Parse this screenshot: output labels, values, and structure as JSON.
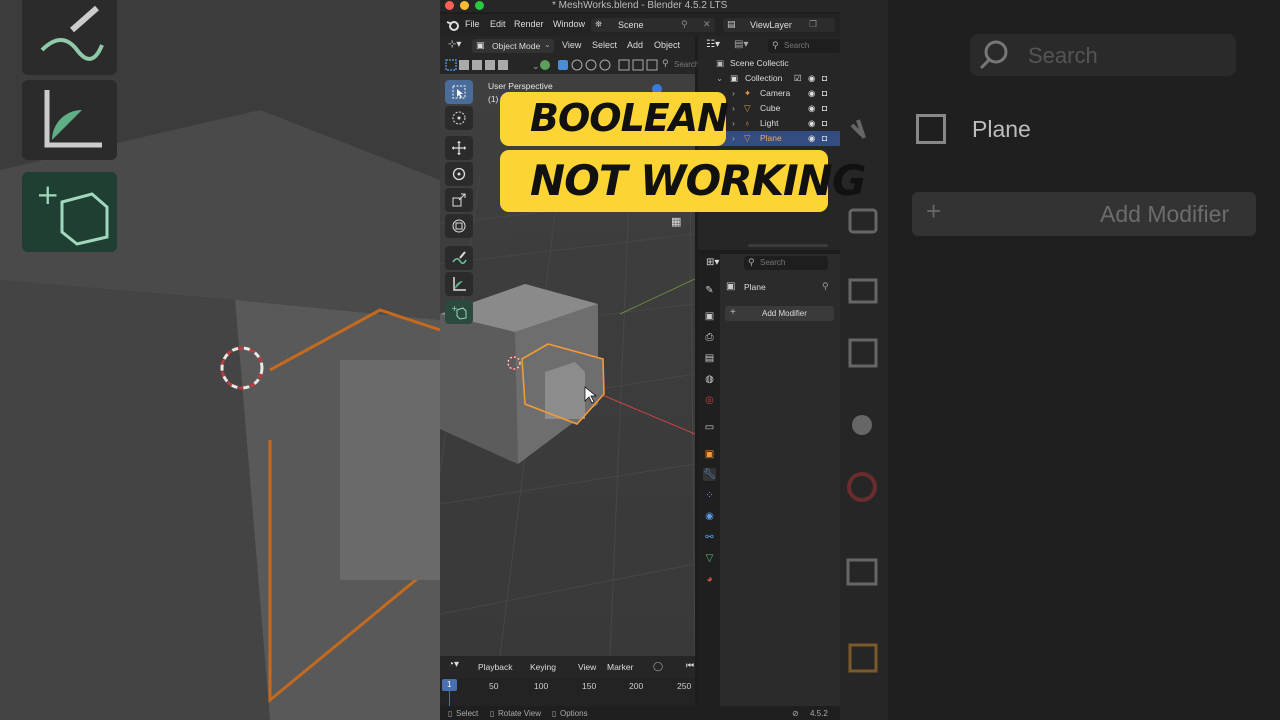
{
  "window": {
    "title": "* MeshWorks.blend - Blender 4.5.2 LTS"
  },
  "topbar": {
    "menus": [
      "File",
      "Edit",
      "Render",
      "Window"
    ],
    "scene": "Scene",
    "view_layer": "ViewLayer"
  },
  "viewport": {
    "mode": "Object Mode",
    "menus": [
      "View",
      "Select",
      "Add",
      "Object"
    ],
    "search_placeholder": "Search",
    "perspective_label": "User Perspective",
    "collection_label": "(1)"
  },
  "overlay": {
    "line1": "BOOLEAN",
    "line2": "NOT WORKING"
  },
  "outliner": {
    "search_placeholder": "Search",
    "root": "Scene Collectic",
    "collection": "Collection",
    "items": [
      {
        "label": "Camera",
        "icon": "camera-icon"
      },
      {
        "label": "Cube",
        "icon": "mesh-icon"
      },
      {
        "label": "Light",
        "icon": "light-icon"
      },
      {
        "label": "Plane",
        "icon": "mesh-icon",
        "selected": true
      }
    ]
  },
  "properties": {
    "search_placeholder": "Search",
    "object_name": "Plane",
    "add_modifier": "Add Modifier"
  },
  "timeline": {
    "menus": [
      "Playback",
      "Keying",
      "View",
      "Marker"
    ],
    "current_frame": "1",
    "ticks": [
      "50",
      "100",
      "150",
      "200",
      "250"
    ]
  },
  "status": {
    "items": [
      "Select",
      "Rotate View",
      "Options"
    ],
    "version": "4.5.2"
  },
  "background_right": {
    "search_placeholder": "Search",
    "object_name": "Plane",
    "add_modifier": "Add Modifier"
  },
  "colors": {
    "accent_yellow": "#fcd534",
    "selection_orange": "#f29a3a",
    "selected_row": "#334d80",
    "active_tool": "#4a6c9a"
  }
}
